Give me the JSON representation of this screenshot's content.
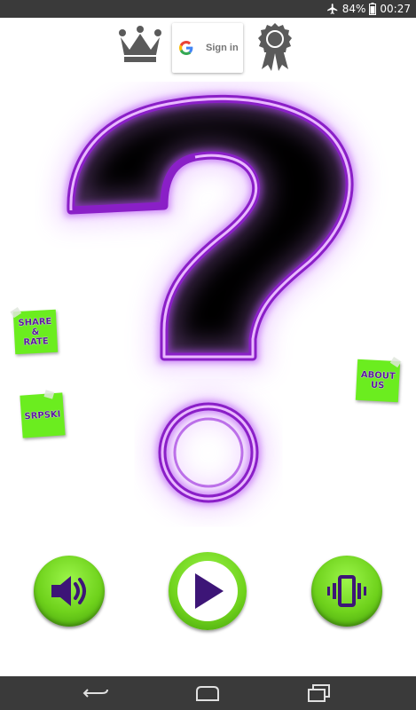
{
  "status_bar": {
    "battery": "84%",
    "time": "00:27",
    "icons": [
      "airplane-mode-icon",
      "battery-icon"
    ]
  },
  "top_bar": {
    "leaderboard_icon": "crown-icon",
    "signin_label": "Sign in",
    "achievements_icon": "award-ribbon-icon"
  },
  "main": {
    "hero_icon": "neon-question-mark",
    "accent_color": "#b04cf0"
  },
  "notes": {
    "share_rate": "SHARE\n&\nRATE",
    "srpski": "SRPSKI",
    "about_us": "ABOUT\nUS",
    "note_color": "#6bed1f",
    "text_color": "#5a1a9e"
  },
  "controls": {
    "sound_icon": "speaker-icon",
    "play_icon": "play-icon",
    "vibrate_icon": "vibrate-icon",
    "button_color": "#6fd21c"
  },
  "nav_bar": {
    "items": [
      "back-icon",
      "home-icon",
      "recents-icon"
    ]
  }
}
